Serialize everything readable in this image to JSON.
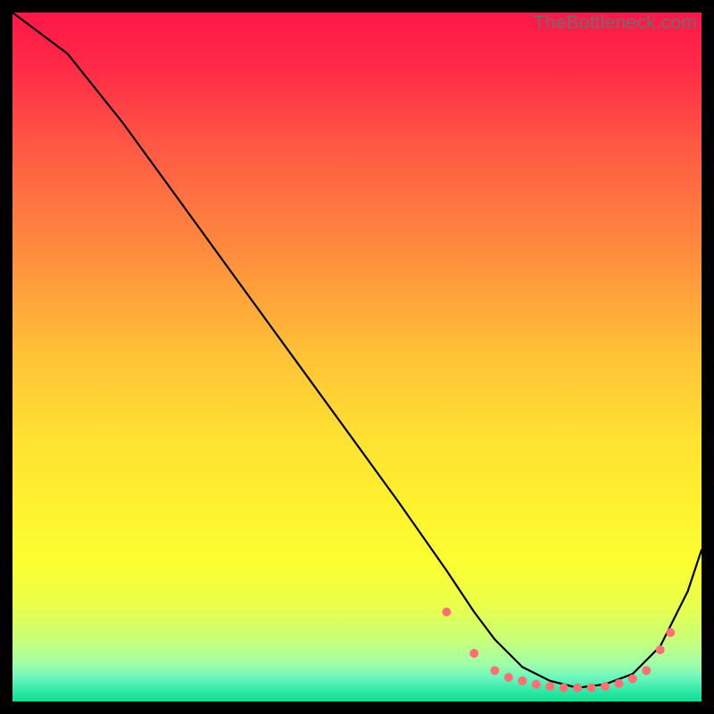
{
  "watermark": "TheBottleneck.com",
  "gradient_stops": [
    {
      "offset": 0.0,
      "color": "#ff1748"
    },
    {
      "offset": 0.08,
      "color": "#ff2a47"
    },
    {
      "offset": 0.2,
      "color": "#ff5b44"
    },
    {
      "offset": 0.35,
      "color": "#ff8d3e"
    },
    {
      "offset": 0.5,
      "color": "#ffc336"
    },
    {
      "offset": 0.62,
      "color": "#ffe232"
    },
    {
      "offset": 0.72,
      "color": "#fff22e"
    },
    {
      "offset": 0.8,
      "color": "#fbff32"
    },
    {
      "offset": 0.86,
      "color": "#eaff4a"
    },
    {
      "offset": 0.91,
      "color": "#c8ff78"
    },
    {
      "offset": 0.945,
      "color": "#a0ffa8"
    },
    {
      "offset": 0.965,
      "color": "#6cf6bd"
    },
    {
      "offset": 0.985,
      "color": "#30e8a6"
    },
    {
      "offset": 1.0,
      "color": "#0fdc8e"
    }
  ],
  "chart_data": {
    "type": "line",
    "title": "",
    "xlabel": "",
    "ylabel": "",
    "xlim": [
      0,
      100
    ],
    "ylim": [
      0,
      100
    ],
    "series": [
      {
        "name": "curve",
        "color": "#000000",
        "x": [
          0,
          8,
          16,
          24,
          32,
          40,
          48,
          56,
          63,
          67,
          70,
          74,
          78,
          82,
          86,
          90,
          94,
          98,
          100
        ],
        "y": [
          100,
          94,
          84,
          73,
          62,
          51,
          40,
          29,
          19,
          13,
          9,
          5,
          3,
          2,
          2.5,
          4,
          8,
          16,
          22
        ]
      }
    ],
    "markers": {
      "name": "bottom-dots",
      "color": "#ff6f73",
      "radius": 5,
      "x": [
        63,
        67,
        70,
        72,
        74,
        76,
        78,
        80,
        82,
        84,
        86,
        88,
        90,
        92,
        94,
        95.5
      ],
      "y": [
        13,
        7,
        4.5,
        3.5,
        3,
        2.5,
        2.2,
        2,
        2,
        2,
        2.2,
        2.6,
        3.3,
        4.5,
        7.5,
        10
      ]
    }
  }
}
